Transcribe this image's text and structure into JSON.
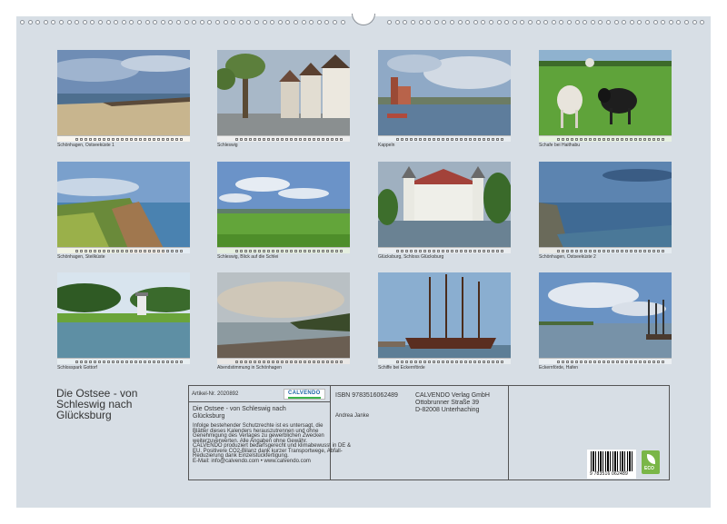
{
  "photos": [
    {
      "caption": "Schönhagen, Ostseeküste 1"
    },
    {
      "caption": "Schleswig"
    },
    {
      "caption": "Kappeln"
    },
    {
      "caption": "Schafe bei Haithabu"
    },
    {
      "caption": "Schönhagen, Steilküste"
    },
    {
      "caption": "Schleswig, Blick auf die Schlei"
    },
    {
      "caption": "Glücksburg, Schloss Glücksburg"
    },
    {
      "caption": "Schönhagen, Ostseeküste 2"
    },
    {
      "caption": "Schlosspark Gottorf"
    },
    {
      "caption": "Abendstimmung in Schönhagen"
    },
    {
      "caption": "Schiffe bei Eckernförde"
    },
    {
      "caption": "Eckernförde, Hafen"
    }
  ],
  "calendar_title": "Die Ostsee - von Schleswig nach Glücksburg",
  "imprint": {
    "article_no": "Artikel-Nr. 2020892",
    "logo_text": "CALVENDO",
    "title_line1": "Die Ostsee - von Schleswig nach",
    "title_line2": "Glücksburg",
    "legal": [
      "Infolge bestehender Schutzrechte ist es untersagt, die",
      "Blätter dieses Kalenders herauszutrennen und ohne",
      "Genehmigung des Verlages zu gewerblichen Zwecken",
      "weiterzuverwerten. Alle Angaben ohne Gewähr.",
      "CALVENDO produziert bedarfsgerecht und klimabewusst in DE &",
      "EU. Positivere CO2-Bilanz dank kurzer Transportwege, Abfall-",
      "Reduzierung dank Einzelstückfertigung.",
      "E-Mail: info@calvendo.com • www.calvendo.com"
    ],
    "isbn": "ISBN 9783516062489",
    "author": "Andrea Janke",
    "publisher": [
      "CALVENDO Verlag GmbH",
      "Ottobrunner Straße 39",
      "D-82008 Unterhaching"
    ],
    "barcode_number": "9 783516 062489",
    "eco_label": "ECO"
  }
}
